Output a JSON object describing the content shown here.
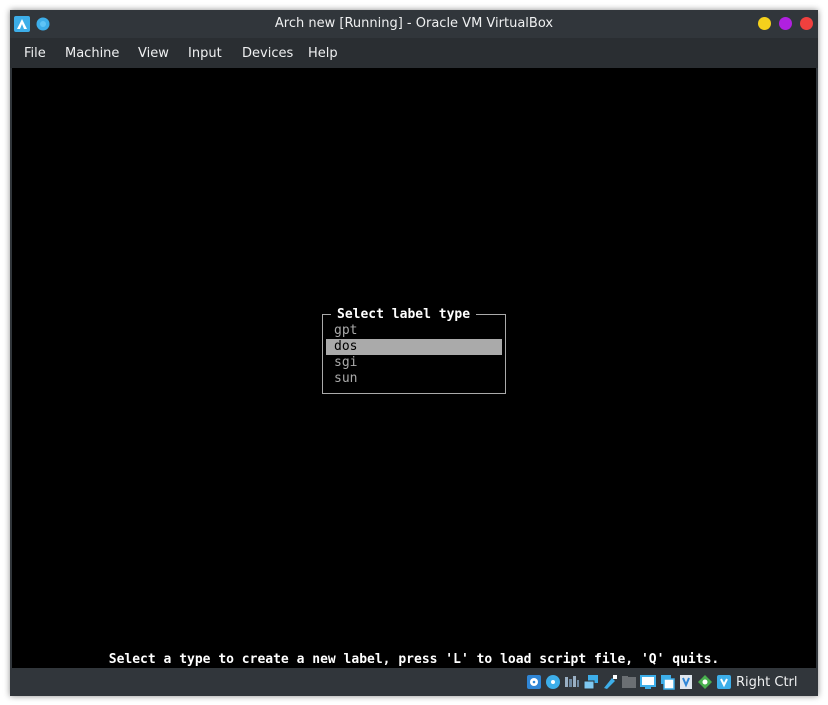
{
  "window": {
    "title": "Arch new [Running] - Oracle VM VirtualBox",
    "controls": {
      "minimize_color": "#f5d11c",
      "maximize_color": "#b020e0",
      "close_color": "#f0403e"
    }
  },
  "menu": {
    "items": [
      "File",
      "Machine",
      "View",
      "Input",
      "Devices",
      "Help"
    ]
  },
  "vm_screen": {
    "dialog": {
      "title": "Select label type",
      "options": [
        "gpt",
        "dos",
        "sgi",
        "sun"
      ],
      "selected": "dos"
    },
    "status_message": "Select a type to create a new label, press 'L' to load script file, 'Q' quits."
  },
  "statusbar": {
    "icons": [
      "hard-disk-icon",
      "optical-drive-icon",
      "audio-icon",
      "network-icon",
      "usb-icon",
      "shared-folders-icon",
      "display-icon",
      "video-capture-icon",
      "virtualization-icon",
      "mouse-integration-icon",
      "keyboard-capture-icon"
    ],
    "host_key": "Right Ctrl"
  }
}
